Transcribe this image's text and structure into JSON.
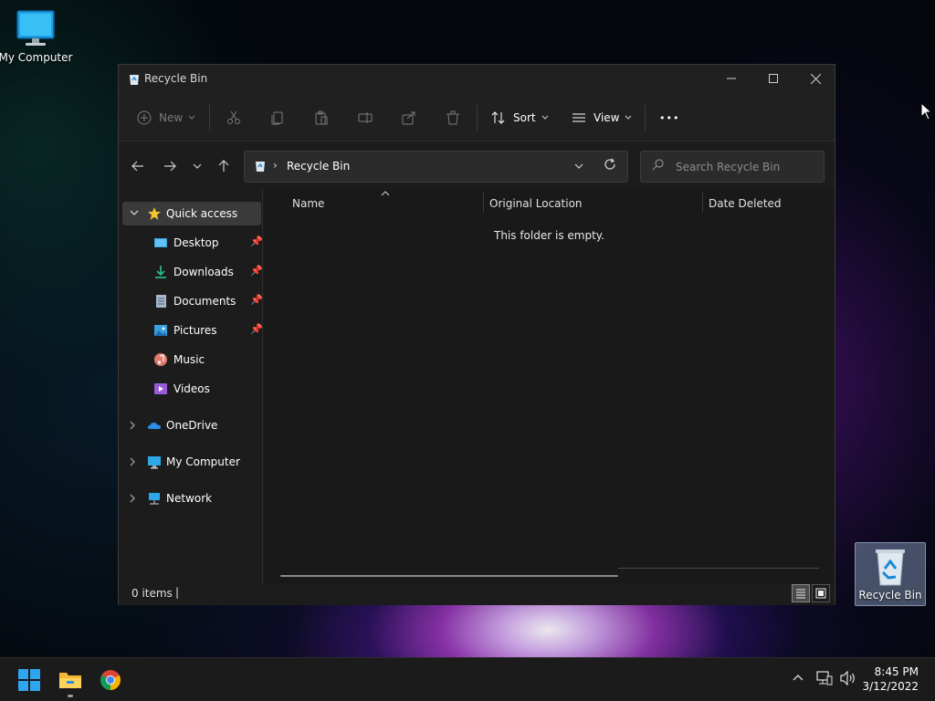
{
  "desktop": {
    "icons": [
      {
        "label": "My Computer"
      },
      {
        "label": "Recycle Bin"
      }
    ]
  },
  "window": {
    "title": "Recycle Bin",
    "controls": {
      "minimize": "—",
      "maximize": "☐",
      "close": "✕"
    }
  },
  "toolbar": {
    "new_label": "New",
    "sort_label": "Sort",
    "view_label": "View",
    "more_label": "•••"
  },
  "address": {
    "path": "Recycle Bin",
    "search_placeholder": "Search Recycle Bin"
  },
  "navpane": {
    "quick_access": "Quick access",
    "items": [
      {
        "label": "Desktop",
        "icon": "desktop-icon",
        "pinned": true
      },
      {
        "label": "Downloads",
        "icon": "downloads-icon",
        "pinned": true
      },
      {
        "label": "Documents",
        "icon": "documents-icon",
        "pinned": true
      },
      {
        "label": "Pictures",
        "icon": "pictures-icon",
        "pinned": true
      },
      {
        "label": "Music",
        "icon": "music-icon",
        "pinned": false
      },
      {
        "label": "Videos",
        "icon": "videos-icon",
        "pinned": false
      }
    ],
    "roots": [
      {
        "label": "OneDrive",
        "icon": "onedrive-icon"
      },
      {
        "label": "My Computer",
        "icon": "computer-icon"
      },
      {
        "label": "Network",
        "icon": "network-icon"
      }
    ]
  },
  "content": {
    "columns": [
      "Name",
      "Original Location",
      "Date Deleted"
    ],
    "empty_message": "This folder is empty."
  },
  "statusbar": {
    "item_count": "0 items",
    "caret": "|"
  },
  "taskbar": {
    "time": "8:45 PM",
    "date": "3/12/2022"
  },
  "colors": {
    "accent": "#0078d4",
    "window_bg": "#1c1c1c",
    "taskbar_bg": "#1b1b1b"
  }
}
